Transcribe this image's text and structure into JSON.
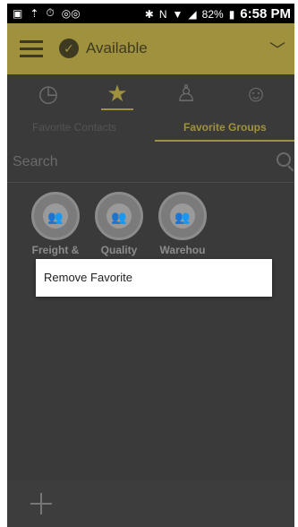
{
  "status_bar": {
    "battery": "82%",
    "time": "6:58 PM"
  },
  "header": {
    "presence_status": "Available"
  },
  "tabs": {
    "contacts": "Favorite Contacts",
    "groups": "Favorite Groups"
  },
  "search": {
    "placeholder": "Search"
  },
  "groups": [
    {
      "label": "Freight &"
    },
    {
      "label": "Quality"
    },
    {
      "label": "Warehou"
    }
  ],
  "context_menu": {
    "item": "Remove Favorite"
  },
  "colors": {
    "accent": "#a0913f",
    "background": "#3a3a3a",
    "statusbar": "#000000"
  },
  "icons": {
    "nav": [
      "recent-clock-icon",
      "favorites-star-icon",
      "contact-person-icon",
      "groups-people-icon"
    ]
  }
}
